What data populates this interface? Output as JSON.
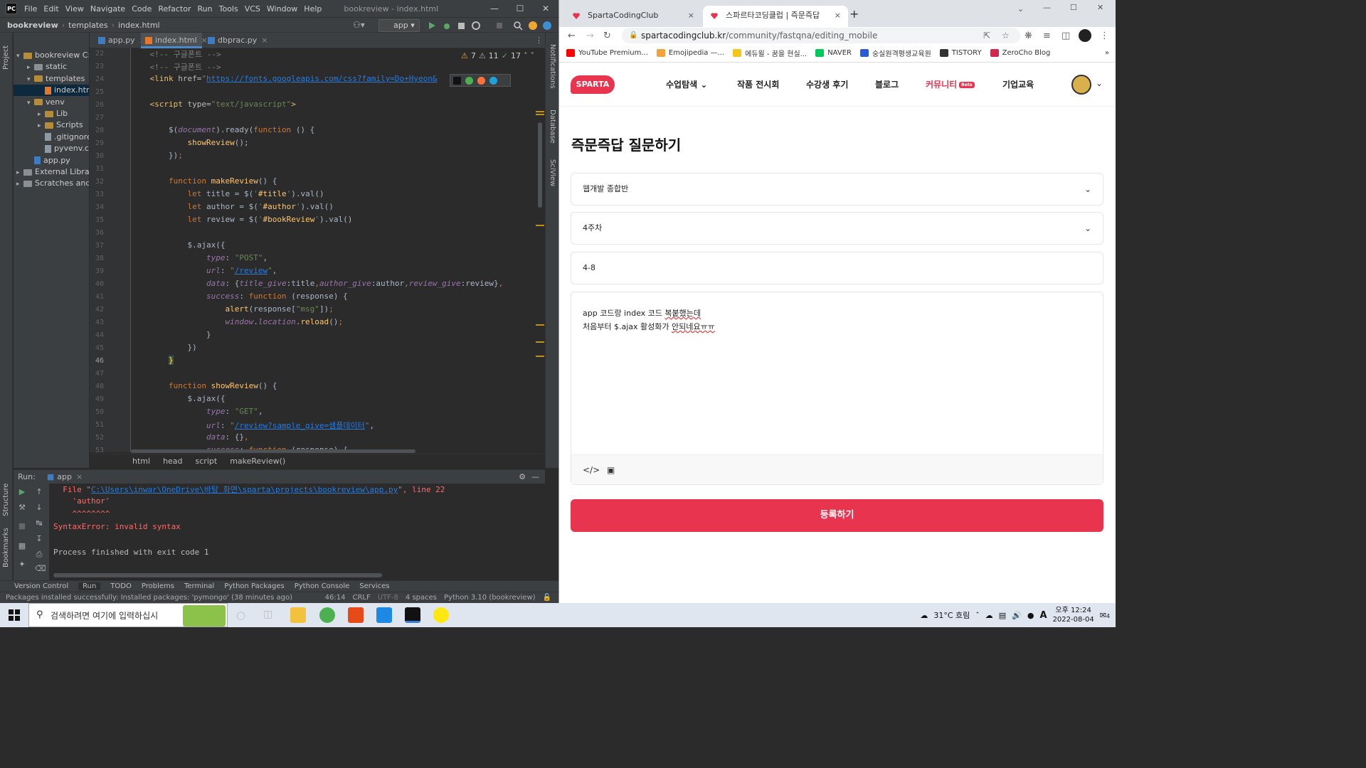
{
  "ide": {
    "window_title": "bookreview - index.html",
    "menu": [
      "File",
      "Edit",
      "View",
      "Navigate",
      "Code",
      "Refactor",
      "Run",
      "Tools",
      "VCS",
      "Window",
      "Help"
    ],
    "breadcrumb": [
      "bookreview",
      "templates",
      "index.html"
    ],
    "run_config": "app",
    "project_label": "Project",
    "tree": [
      {
        "label": "bookreview",
        "suffix": "C:\\",
        "type": "folder",
        "indent": 0,
        "open": true
      },
      {
        "label": "static",
        "type": "folder",
        "indent": 1
      },
      {
        "label": "templates",
        "type": "folder",
        "indent": 1,
        "open": true
      },
      {
        "label": "index.htm",
        "type": "html",
        "indent": 2,
        "selected": true
      },
      {
        "label": "venv",
        "type": "folder",
        "indent": 1,
        "open": true
      },
      {
        "label": "Lib",
        "type": "folder",
        "indent": 2
      },
      {
        "label": "Scripts",
        "type": "folder",
        "indent": 2
      },
      {
        "label": ".gitignore",
        "type": "file",
        "indent": 2
      },
      {
        "label": "pyvenv.cfg",
        "type": "file",
        "indent": 2
      },
      {
        "label": "app.py",
        "type": "py",
        "indent": 1
      },
      {
        "label": "External Libraries",
        "type": "lib",
        "indent": 0
      },
      {
        "label": "Scratches and C",
        "type": "lib",
        "indent": 0
      }
    ],
    "tabs": [
      {
        "label": "app.py",
        "active": false
      },
      {
        "label": "index.html",
        "active": true
      },
      {
        "label": "dbprac.py",
        "active": false
      }
    ],
    "inspections": {
      "warn": "7",
      "weak": "11",
      "ok": "17"
    },
    "line_numbers": [
      "22",
      "23",
      "24",
      "25",
      "26",
      "27",
      "28",
      "29",
      "30",
      "31",
      "32",
      "33",
      "34",
      "35",
      "36",
      "37",
      "38",
      "39",
      "40",
      "41",
      "42",
      "43",
      "44",
      "45",
      "46",
      "47",
      "48",
      "49",
      "50",
      "51",
      "52",
      "53"
    ],
    "current_line": "46",
    "editor_breadcrumb": [
      "html",
      "head",
      "script",
      "makeReview()"
    ],
    "right_tools": [
      "Notifications",
      "Database",
      "SciView"
    ],
    "left_tools": [
      "Project",
      "Structure",
      "Bookmarks"
    ],
    "run": {
      "label": "Run:",
      "config": "app",
      "file_prefix": "  File \"",
      "file_path": "C:\\Users\\inwar\\OneDrive\\바탕 화면\\sparta\\projects\\bookreview\\app.py",
      "file_suffix": "\", line 22",
      "line2": "    'author'",
      "line3": "    ^^^^^^^^",
      "error": "SyntaxError: invalid syntax",
      "finished": "Process finished with exit code 1"
    },
    "bottom_tabs": [
      "Version Control",
      "Run",
      "TODO",
      "Problems",
      "Terminal",
      "Python Packages",
      "Python Console",
      "Services"
    ],
    "status": {
      "message": "Packages installed successfully: Installed packages: 'pymongo' (38 minutes ago)",
      "position": "46:14",
      "line_sep": "CRLF",
      "encoding": "UTF-8",
      "indent": "4 spaces",
      "interpreter": "Python 3.10 (bookreview)"
    }
  },
  "browser": {
    "tabs": [
      {
        "label": "SpartaCodingClub",
        "active": false
      },
      {
        "label": "스파르타코딩클럽 | 즉문즉답",
        "active": true
      }
    ],
    "url_host": "spartacodingclub.kr",
    "url_path": "/community/fastqna/editing_mobile",
    "bookmarks": [
      "YouTube Premium...",
      "Emojipedia —...",
      "에듀윌 - 꿈을 현실...",
      "NAVER",
      "숭실원격평생교육원",
      "TISTORY",
      "ZeroCho Blog"
    ],
    "site": {
      "logo": "SPARTA",
      "nav": [
        "수업탐색",
        "작품 전시회",
        "수강생 후기",
        "블로그",
        "커뮤니티",
        "기업교육"
      ],
      "beta": "Beta",
      "page_title": "즉문즉답 질문하기",
      "course_select": "웹개발 종합반",
      "week_select": "4주차",
      "title_input": "4-8",
      "body_line1_a": "app 코드랑 index 코드 ",
      "body_line1_b": "복붙했는데",
      "body_line2_a": "처음부터 $.ajax 활성화가 ",
      "body_line2_b": "안되네요ㅠㅠ",
      "submit": "등록하기"
    }
  },
  "taskbar": {
    "search_placeholder": "검색하려면 여기에 입력하십시",
    "weather": "31°C 흐림",
    "time": "오후 12:24",
    "date": "2022-08-04",
    "ime": "A",
    "notif": "4"
  },
  "colors": {
    "accent": "#e8344e",
    "ide_bg": "#2b2b2b",
    "ide_panel": "#3c3f41"
  }
}
